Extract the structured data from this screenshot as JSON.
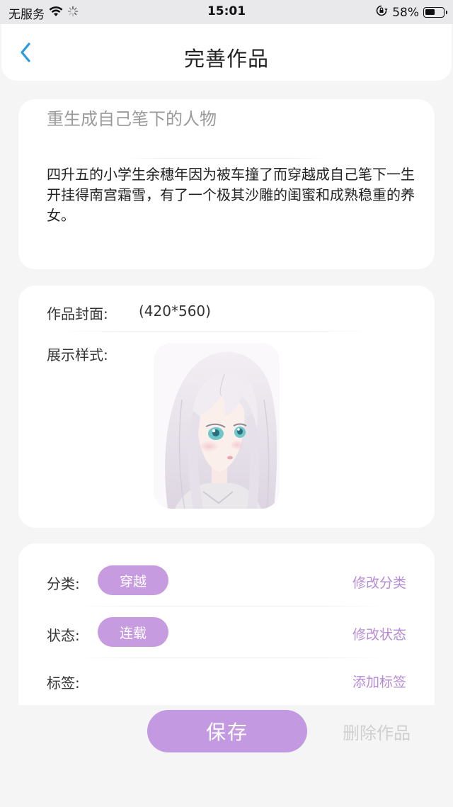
{
  "status_bar": {
    "carrier": "无服务",
    "time": "15:01",
    "battery": "58%",
    "battery_level": 0.58
  },
  "header": {
    "title": "完善作品"
  },
  "intro": {
    "title": "重生成自己笔下的人物",
    "description": "四升五的小学生余穗年因为被车撞了而穿越成自己笔下一生开挂得南宫霜雪，有了一个极其沙雕的闺蜜和成熟稳重的养女。"
  },
  "cover": {
    "label": "作品封面:",
    "size_hint": "(420*560)",
    "display_label": "展示样式:"
  },
  "meta": {
    "category_label": "分类:",
    "category_value": "穿越",
    "category_action": "修改分类",
    "status_label": "状态:",
    "status_value": "连载",
    "status_action": "修改状态",
    "tags_label": "标签:",
    "tags_action": "添加标签"
  },
  "actions": {
    "save": "保存",
    "delete": "删除作品"
  },
  "colors": {
    "accent": "#c79bdf",
    "accent_text": "#b58ad6",
    "back_arrow": "#2a9be0",
    "background": "#f5f5f5"
  },
  "icons": {
    "back": "chevron-left-icon",
    "wifi": "wifi-icon",
    "loading": "activity-spinner-icon",
    "orientation_lock": "orientation-lock-icon",
    "battery": "battery-icon"
  }
}
